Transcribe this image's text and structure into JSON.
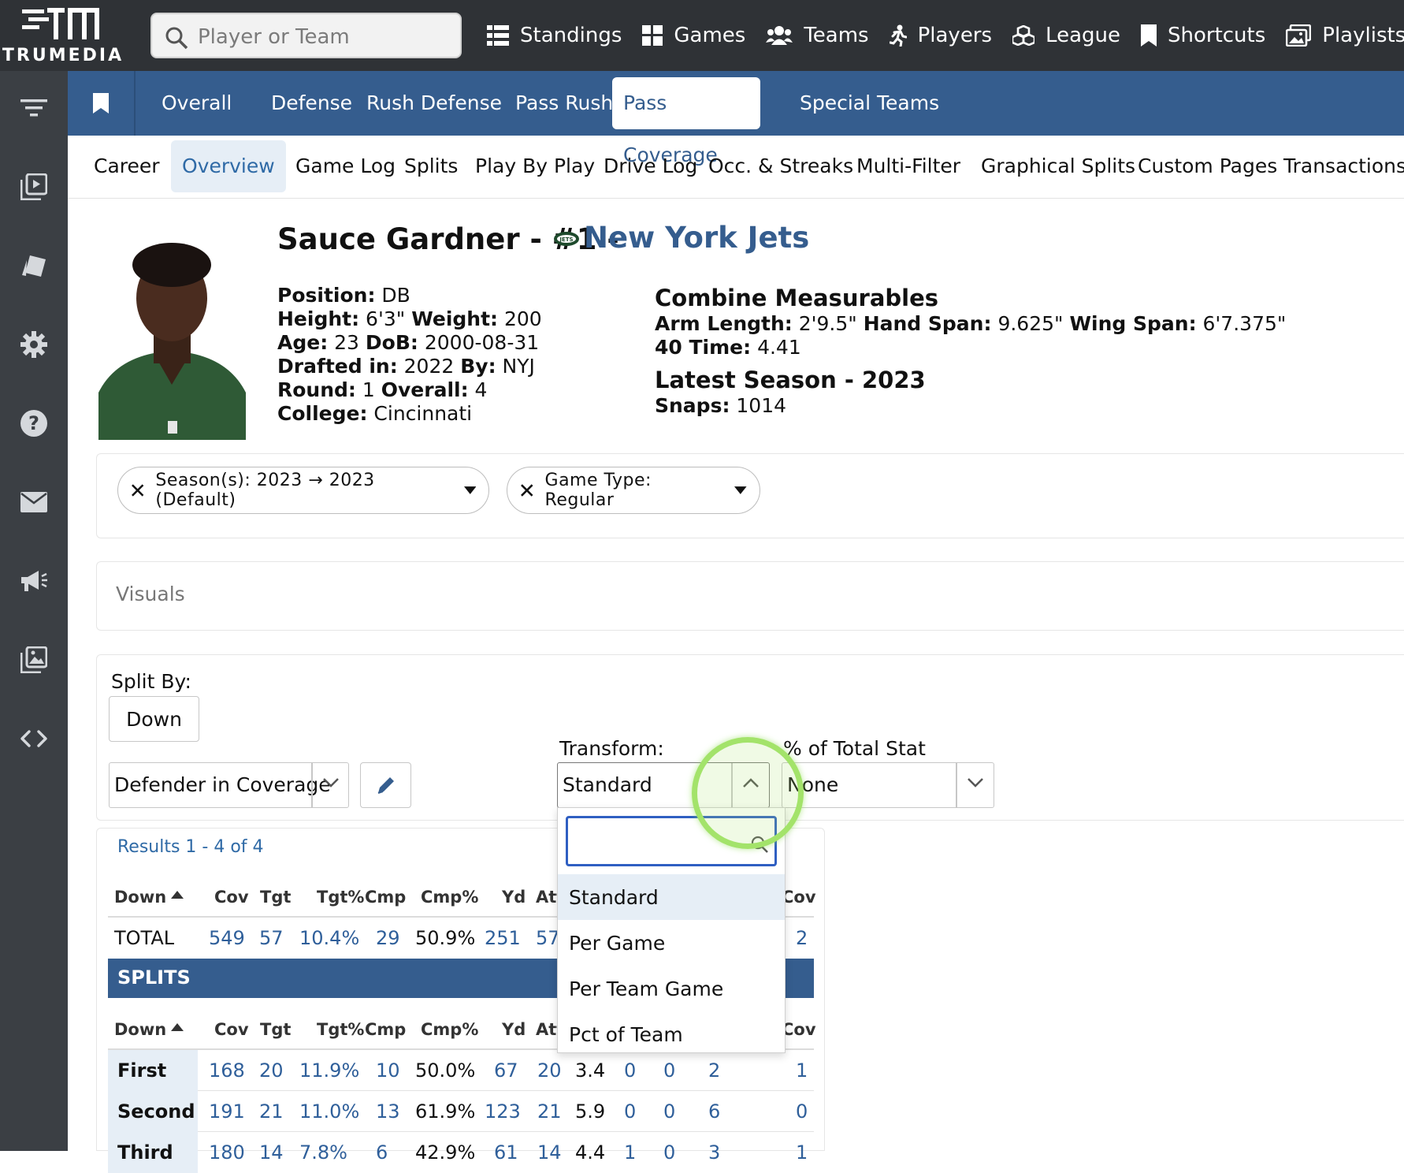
{
  "app": {
    "brand": "TRUMEDIA"
  },
  "search": {
    "placeholder": "Player or Team"
  },
  "topnav": [
    {
      "label": "Standings",
      "icon": "table-icon"
    },
    {
      "label": "Games",
      "icon": "grid-icon"
    },
    {
      "label": "Teams",
      "icon": "users-icon"
    },
    {
      "label": "Players",
      "icon": "running-icon"
    },
    {
      "label": "League",
      "icon": "cubes-icon"
    },
    {
      "label": "Shortcuts",
      "icon": "bookmark-icon"
    },
    {
      "label": "Playlists",
      "icon": "photos-icon"
    }
  ],
  "category_tabs": [
    "Overall",
    "Defense",
    "Rush Defense",
    "Pass Rush",
    "Pass Coverage",
    "Special Teams"
  ],
  "active_category": "Pass Coverage",
  "page_tabs": [
    "Career",
    "Overview",
    "Game Log",
    "Splits",
    "Play By Play",
    "Drive Log",
    "Occ. & Streaks",
    "Multi-Filter",
    "Graphical Splits",
    "Custom Pages",
    "Transactions"
  ],
  "active_page_tab": "Overview",
  "player": {
    "name_line": "Sauce Gardner - #1 -",
    "team": "New York Jets",
    "position_label": "Position:",
    "position": "DB",
    "height_label": "Height:",
    "height": "6'3\"",
    "weight_label": "Weight:",
    "weight": "200",
    "age_label": "Age:",
    "age": "23",
    "dob_label": "DoB:",
    "dob": "2000-08-31",
    "drafted_label": "Drafted in:",
    "drafted": "2022",
    "by_label": "By:",
    "by": "NYJ",
    "round_label": "Round:",
    "round": "1",
    "overall_label": "Overall:",
    "overall": "4",
    "college_label": "College:",
    "college": "Cincinnati"
  },
  "combine": {
    "title": "Combine Measurables",
    "arm_label": "Arm Length:",
    "arm": "2'9.5\"",
    "hand_label": "Hand Span:",
    "hand": "9.625\"",
    "wing_label": "Wing Span:",
    "wing": "6'7.375\"",
    "forty_label": "40 Time:",
    "forty": "4.41",
    "season_title": "Latest Season - 2023",
    "snaps_label": "Snaps:",
    "snaps": "1014"
  },
  "filters": {
    "season": "Season(s): 2023 → 2023 (Default)",
    "game_type": "Game Type: Regular"
  },
  "visuals_label": "Visuals",
  "split": {
    "split_by_label": "Split By:",
    "split_by_value": "Down",
    "defender_value": "Defender in Coverage",
    "transform_label": "Transform:",
    "transform_value": "Standard",
    "pct_label": "% of Total Stat",
    "pct_value": "None"
  },
  "dropdown": {
    "options": [
      "Standard",
      "Per Game",
      "Per Team Game",
      "Pct of Team"
    ]
  },
  "table": {
    "results": "Results 1 - 4 of 4",
    "columns": [
      "Down",
      "Cov",
      "Tgt",
      "Tgt%",
      "Cmp",
      "Cmp%",
      "Yd",
      "Att",
      "Cov"
    ],
    "total": {
      "label": "TOTAL",
      "values": [
        "549",
        "57",
        "10.4%",
        "29",
        "50.9%",
        "251",
        "57",
        "2"
      ]
    },
    "splits_label": "SPLITS",
    "rows": [
      {
        "label": "First",
        "values": [
          "168",
          "20",
          "11.9%",
          "10",
          "50.0%",
          "67",
          "20",
          "3.4",
          "0",
          "0",
          "2",
          "1"
        ]
      },
      {
        "label": "Second",
        "values": [
          "191",
          "21",
          "11.0%",
          "13",
          "61.9%",
          "123",
          "21",
          "5.9",
          "0",
          "0",
          "6",
          "0"
        ]
      },
      {
        "label": "Third",
        "values": [
          "180",
          "14",
          "7.8%",
          "6",
          "42.9%",
          "61",
          "14",
          "4.4",
          "1",
          "0",
          "3",
          "1"
        ]
      }
    ]
  }
}
